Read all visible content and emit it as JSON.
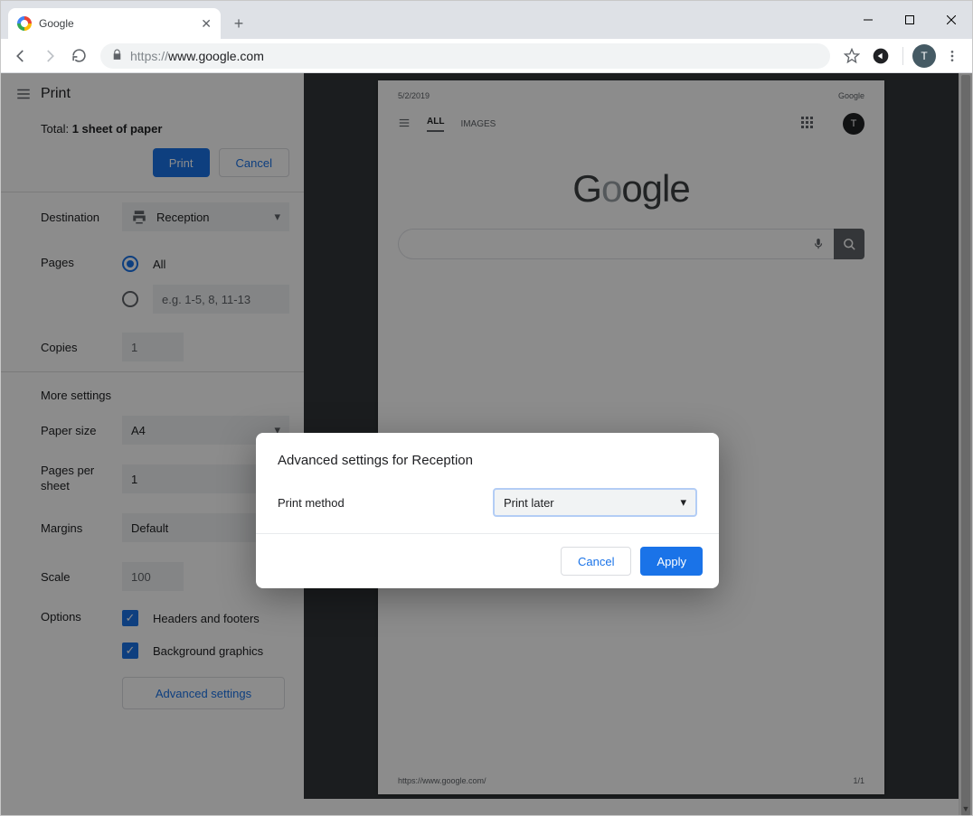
{
  "browser": {
    "tab_title": "Google",
    "url_prefix": "https://",
    "url_host": "www.google.com",
    "avatar_letter": "T"
  },
  "print": {
    "title": "Print",
    "total_prefix": "Total: ",
    "total_value": "1 sheet of paper",
    "print_button": "Print",
    "cancel_button": "Cancel",
    "destination_label": "Destination",
    "destination_value": "Reception",
    "pages_label": "Pages",
    "pages_all": "All",
    "pages_custom_placeholder": "e.g. 1-5, 8, 11-13",
    "copies_label": "Copies",
    "copies_value": "1",
    "more_settings": "More settings",
    "paper_size_label": "Paper size",
    "paper_size_value": "A4",
    "pps_label": "Pages per sheet",
    "pps_value": "1",
    "margins_label": "Margins",
    "margins_value": "Default",
    "scale_label": "Scale",
    "scale_value": "100",
    "options_label": "Options",
    "opt_headers": "Headers and footers",
    "opt_background": "Background graphics",
    "advanced_button": "Advanced settings"
  },
  "preview": {
    "date": "5/2/2019",
    "title": "Google",
    "nav_all": "ALL",
    "nav_images": "IMAGES",
    "avatar_letter": "T",
    "footer_url": "https://www.google.com/",
    "footer_page": "1/1"
  },
  "modal": {
    "title": "Advanced settings for Reception",
    "field_label": "Print method",
    "field_value": "Print later",
    "cancel": "Cancel",
    "apply": "Apply"
  }
}
